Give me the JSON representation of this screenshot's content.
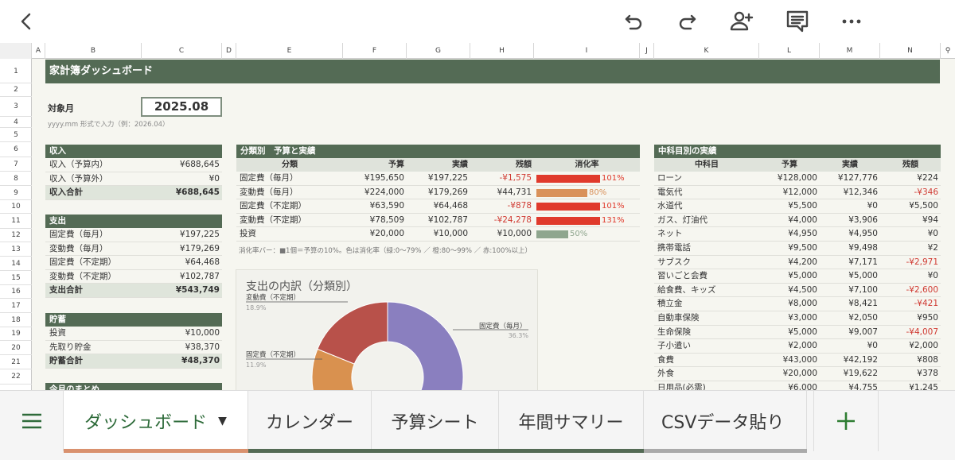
{
  "colors": {
    "header": "#546b55",
    "subheader": "#dfe3db",
    "red": "#d03a32",
    "orange": "#d9915a",
    "green": "#8fa68e",
    "accent": "#2e7d32"
  },
  "icons": [
    "back-icon",
    "undo-icon",
    "redo-icon",
    "add-person-icon",
    "comment-icon",
    "more-icon",
    "menu-icon",
    "plus-icon",
    "chevron-down-icon"
  ],
  "columns": [
    "A",
    "B",
    "C",
    "D",
    "E",
    "F",
    "G",
    "H",
    "I",
    "J",
    "K",
    "L",
    "M",
    "N"
  ],
  "rows": [
    "1",
    "2",
    "3",
    "4",
    "5",
    "6",
    "7",
    "8",
    "9",
    "10",
    "11",
    "12",
    "13",
    "14",
    "15",
    "16",
    "17",
    "18",
    "19",
    "20",
    "21",
    "22"
  ],
  "dashboard": {
    "title": "家計簿ダッシュボード",
    "month_label": "対象月",
    "month_value": "2025.08",
    "month_hint": "yyyy.mm 形式で入力（例：2026.04）"
  },
  "income": {
    "header": "収入",
    "rows": [
      {
        "label": "収入（予算内）",
        "value": "¥688,645"
      },
      {
        "label": "収入（予算外）",
        "value": "¥0"
      },
      {
        "label": "収入合計",
        "value": "¥688,645"
      }
    ]
  },
  "expense": {
    "header": "支出",
    "rows": [
      {
        "label": "固定費（毎月）",
        "value": "¥197,225"
      },
      {
        "label": "変動費（毎月）",
        "value": "¥179,269"
      },
      {
        "label": "固定費（不定期）",
        "value": "¥64,468"
      },
      {
        "label": "変動費（不定期）",
        "value": "¥102,787"
      },
      {
        "label": "支出合計",
        "value": "¥543,749"
      }
    ]
  },
  "savings": {
    "header": "貯蓄",
    "rows": [
      {
        "label": "投資",
        "value": "¥10,000"
      },
      {
        "label": "先取り貯金",
        "value": "¥38,370"
      },
      {
        "label": "貯蓄合計",
        "value": "¥48,370"
      }
    ]
  },
  "summary": {
    "header": "今月のまとめ"
  },
  "budget": {
    "header": "分類別　予算と実績",
    "cols": [
      "分類",
      "予算",
      "実績",
      "残額",
      "消化率"
    ],
    "rows": [
      {
        "name": "固定費（毎月）",
        "budget": "¥195,650",
        "actual": "¥197,225",
        "remain": "-¥1,575",
        "rate": "101%",
        "rate_value": 1.01,
        "color": "#e03a2c",
        "neg": true
      },
      {
        "name": "変動費（毎月）",
        "budget": "¥224,000",
        "actual": "¥179,269",
        "remain": "¥44,731",
        "rate": "80%",
        "rate_value": 0.8,
        "color": "#d9915a",
        "neg": false
      },
      {
        "name": "固定費（不定期）",
        "budget": "¥63,590",
        "actual": "¥64,468",
        "remain": "-¥878",
        "rate": "101%",
        "rate_value": 1.01,
        "color": "#e03a2c",
        "neg": true
      },
      {
        "name": "変動費（不定期）",
        "budget": "¥78,509",
        "actual": "¥102,787",
        "remain": "-¥24,278",
        "rate": "131%",
        "rate_value": 1.31,
        "color": "#e03a2c",
        "neg": true
      },
      {
        "name": "投資",
        "budget": "¥20,000",
        "actual": "¥10,000",
        "remain": "¥10,000",
        "rate": "50%",
        "rate_value": 0.5,
        "color": "#8fa68e",
        "neg": false
      }
    ],
    "note": "消化率バー：■1個＝予算の10%。色は消化率（緑:0〜79% ／ 橙:80〜99% ／ 赤:100%以上）"
  },
  "chart_data": {
    "type": "pie",
    "title": "支出の内訳（分類別）",
    "categories": [
      "固定費（毎月）",
      "変動費（毎月）",
      "固定費（不定期）",
      "変動費（不定期）"
    ],
    "values": [
      36.3,
      33.0,
      11.9,
      18.9
    ],
    "labels": [
      {
        "name": "固定費（毎月）",
        "pct": "36.3%"
      },
      {
        "name": "固定費（不定期）",
        "pct": "11.9%"
      },
      {
        "name": "変動費（不定期）",
        "pct": "18.9%"
      }
    ],
    "colors": [
      "#8a7fbf",
      "#e0b34a",
      "#d9914f",
      "#b8514a"
    ]
  },
  "sub": {
    "header": "中科目別の実績",
    "cols": [
      "中科目",
      "予算",
      "実績",
      "残額"
    ],
    "rows": [
      {
        "name": "ローン",
        "budget": "¥128,000",
        "actual": "¥127,776",
        "remain": "¥224",
        "neg": false
      },
      {
        "name": "電気代",
        "budget": "¥12,000",
        "actual": "¥12,346",
        "remain": "-¥346",
        "neg": true
      },
      {
        "name": "水道代",
        "budget": "¥5,500",
        "actual": "¥0",
        "remain": "¥5,500",
        "neg": false
      },
      {
        "name": "ガス、灯油代",
        "budget": "¥4,000",
        "actual": "¥3,906",
        "remain": "¥94",
        "neg": false
      },
      {
        "name": "ネット",
        "budget": "¥4,950",
        "actual": "¥4,950",
        "remain": "¥0",
        "neg": false
      },
      {
        "name": "携帯電話",
        "budget": "¥9,500",
        "actual": "¥9,498",
        "remain": "¥2",
        "neg": false
      },
      {
        "name": "サブスク",
        "budget": "¥4,200",
        "actual": "¥7,171",
        "remain": "-¥2,971",
        "neg": true
      },
      {
        "name": "習いごと会費",
        "budget": "¥5,000",
        "actual": "¥5,000",
        "remain": "¥0",
        "neg": false
      },
      {
        "name": "給食費、キッズ",
        "budget": "¥4,500",
        "actual": "¥7,100",
        "remain": "-¥2,600",
        "neg": true
      },
      {
        "name": "積立金",
        "budget": "¥8,000",
        "actual": "¥8,421",
        "remain": "-¥421",
        "neg": true
      },
      {
        "name": "自動車保険",
        "budget": "¥3,000",
        "actual": "¥2,050",
        "remain": "¥950",
        "neg": false
      },
      {
        "name": "生命保険",
        "budget": "¥5,000",
        "actual": "¥9,007",
        "remain": "-¥4,007",
        "neg": true
      },
      {
        "name": "子小遣い",
        "budget": "¥2,000",
        "actual": "¥0",
        "remain": "¥2,000",
        "neg": false
      },
      {
        "name": "食費",
        "budget": "¥43,000",
        "actual": "¥42,192",
        "remain": "¥808",
        "neg": false
      },
      {
        "name": "外食",
        "budget": "¥20,000",
        "actual": "¥19,622",
        "remain": "¥378",
        "neg": false
      },
      {
        "name": "日用品(必需)",
        "budget": "¥6,000",
        "actual": "¥4,755",
        "remain": "¥1,245",
        "neg": false
      }
    ]
  },
  "tabs": [
    {
      "label": "ダッシュボード",
      "active": true,
      "bar": "#d9916e"
    },
    {
      "label": "カレンダー",
      "active": false,
      "bar": "#546b55"
    },
    {
      "label": "予算シート",
      "active": false,
      "bar": "#546b55"
    },
    {
      "label": "年間サマリー",
      "active": false,
      "bar": "#546b55"
    },
    {
      "label": "CSVデータ貼り",
      "active": false,
      "bar": "#aaaaaa"
    }
  ]
}
